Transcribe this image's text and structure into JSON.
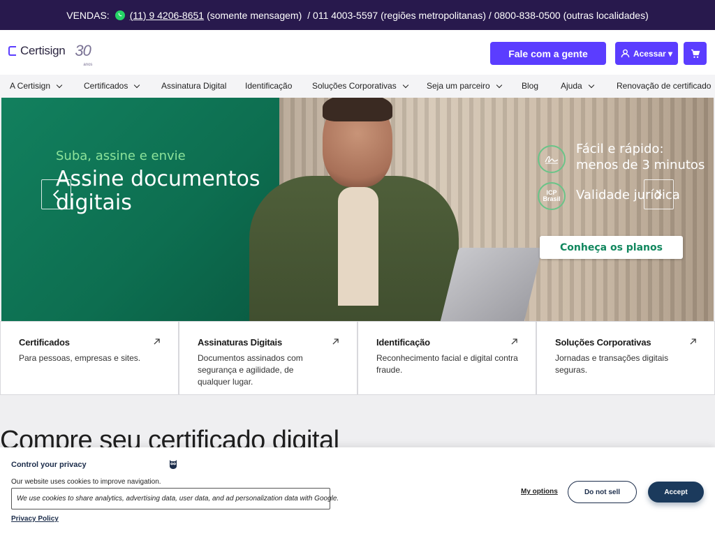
{
  "topbar": {
    "sales_label": "VENDAS:",
    "whatsapp_phone": "(11) 9 4206-8651",
    "whatsapp_note": "(somente mensagem)",
    "other_phones": "/ 011 4003-5597 (regiões metropolitanas) / 0800-838-0500 (outras localidades)"
  },
  "header": {
    "logo_text": "Certisign",
    "logo_anniversary": "30",
    "logo_anniversary_sub": "anos",
    "contact_button": "Fale com a gente",
    "login_button": "Acessar ▾"
  },
  "nav": {
    "items": [
      {
        "label": "A Certisign",
        "dropdown": true
      },
      {
        "label": "Certificados",
        "dropdown": true
      },
      {
        "label": "Assinatura Digital",
        "dropdown": false
      },
      {
        "label": "Identificação",
        "dropdown": false
      },
      {
        "label": "Soluções Corporativas",
        "dropdown": true
      },
      {
        "label": "Seja um parceiro",
        "dropdown": true
      },
      {
        "label": "Blog",
        "dropdown": false
      },
      {
        "label": "Ajuda",
        "dropdown": true
      },
      {
        "label": "Renovação de certificado",
        "dropdown": false
      }
    ]
  },
  "hero": {
    "subtitle": "Suba, assine e envie",
    "title": "Assine documentos digitais",
    "features": [
      {
        "icon": "signature-icon",
        "text": "Fácil e rápido: menos de 3 minutos"
      },
      {
        "icon": "icp-brasil-icon",
        "icon_text": "ICP Brasil",
        "text": "Validade jurídica"
      }
    ],
    "cta": "Conheça os planos"
  },
  "cards": [
    {
      "title": "Certificados",
      "desc": "Para pessoas, empresas e sites."
    },
    {
      "title": "Assinaturas Digitais",
      "desc": "Documentos assinados com segurança e agilidade, de qualquer lugar."
    },
    {
      "title": "Identificação",
      "desc": "Reconhecimento facial e digital contra fraude."
    },
    {
      "title": "Soluções Corporativas",
      "desc": "Jornadas e transações digitais seguras."
    }
  ],
  "section": {
    "title": "Compre seu certificado digital"
  },
  "cookie": {
    "title": "Control your privacy",
    "text": "Our website uses cookies to improve navigation.",
    "detail": "We use cookies to share analytics, advertising data, user data, and ad personalization data with Google.",
    "privacy_link": "Privacy Policy",
    "options_link": "My options",
    "do_not_sell": "Do not sell",
    "accept": "Accept"
  },
  "colors": {
    "topbar_bg": "#28194d",
    "brand_purple": "#5b3dff",
    "hero_green": "#12805e",
    "accept_blue": "#1b3a5c"
  }
}
